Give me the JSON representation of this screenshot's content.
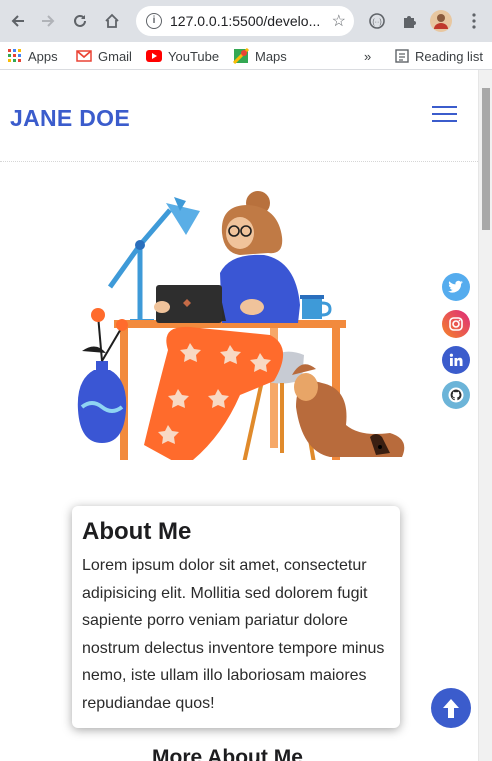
{
  "browser": {
    "url": "127.0.0.1:5500/develo...",
    "bookmarks": [
      {
        "label": "Apps"
      },
      {
        "label": "Gmail"
      },
      {
        "label": "YouTube"
      },
      {
        "label": "Maps"
      }
    ],
    "overflow_label": "»",
    "reading_list": "Reading list"
  },
  "site": {
    "brand": "JANE DOE",
    "about_title": "About Me",
    "about_text": "Lorem ipsum dolor sit amet, consectetur adipisicing elit. Mollitia sed dolorem fugit sapiente porro veniam pariatur dolore nostrum delectus inventore tempore minus nemo, iste ullam illo laboriosam maiores repudiandae quos!",
    "more_title": "More About Me"
  },
  "social": [
    {
      "name": "twitter",
      "icon": "twitter-icon",
      "color": "#55acee"
    },
    {
      "name": "instagram",
      "icon": "instagram-icon",
      "color": "#f58529"
    },
    {
      "name": "linkedin",
      "icon": "linkedin-icon",
      "color": "#3b5ccc"
    },
    {
      "name": "github",
      "icon": "github-icon",
      "color": "#6cb4d8"
    }
  ],
  "colors": {
    "accent": "#3b5ccc"
  }
}
